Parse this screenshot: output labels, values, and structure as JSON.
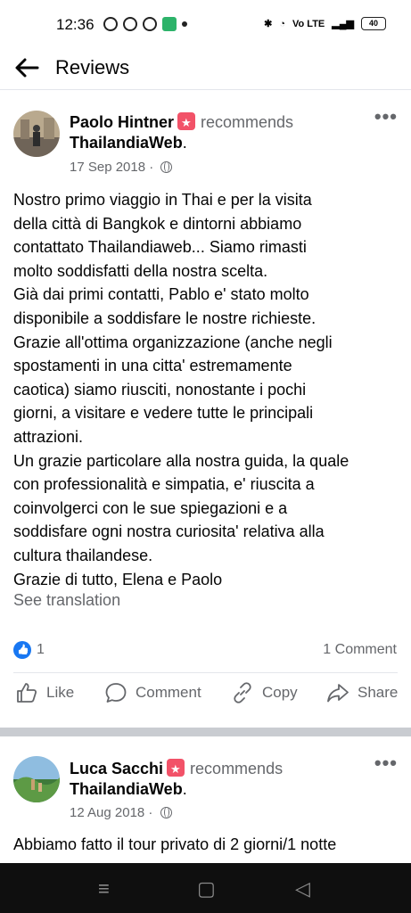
{
  "status_bar": {
    "time": "12:36",
    "battery": "40",
    "net_label": "Vo LTE"
  },
  "header": {
    "title": "Reviews"
  },
  "reviews": [
    {
      "author": "Paolo Hintner",
      "verb": "recommends",
      "page": "ThailandiaWeb",
      "date": "17 Sep 2018",
      "text": "Nostro primo viaggio in Thai e per la visita\ndella città di Bangkok e dintorni abbiamo\ncontattato Thailandiaweb... Siamo rimasti\nmolto soddisfatti della nostra scelta.\nGià dai primi contatti, Pablo e' stato molto\ndisponibile a soddisfare le nostre richieste.\nGrazie all'ottima organizzazione (anche negli\nspostamenti in una citta' estremamente\ncaotica) siamo riusciti, nonostante i pochi\ngiorni, a visitare e vedere tutte le principali\nattrazioni.\nUn grazie particolare alla nostra guida, la quale\ncon professionalità e simpatia, e' riuscita a\ncoinvolgerci con le sue spiegazioni e a\nsoddisfare ogni nostra curiosita' relativa alla\ncultura thailandese.\nGrazie di tutto, Elena e Paolo",
      "see_translation": "See translation",
      "likes": "1",
      "comments": "1 Comment",
      "actions": {
        "like": "Like",
        "comment": "Comment",
        "copy": "Copy",
        "share": "Share"
      }
    },
    {
      "author": "Luca Sacchi",
      "verb": "recommends",
      "page": "ThailandiaWeb",
      "date": "12 Aug 2018",
      "text": "Abbiamo fatto il tour privato di 2 giorni/1 notte"
    }
  ],
  "colors": {
    "accent": "#1877f2",
    "recommend_badge": "#f25268",
    "secondary_text": "#65676b"
  }
}
